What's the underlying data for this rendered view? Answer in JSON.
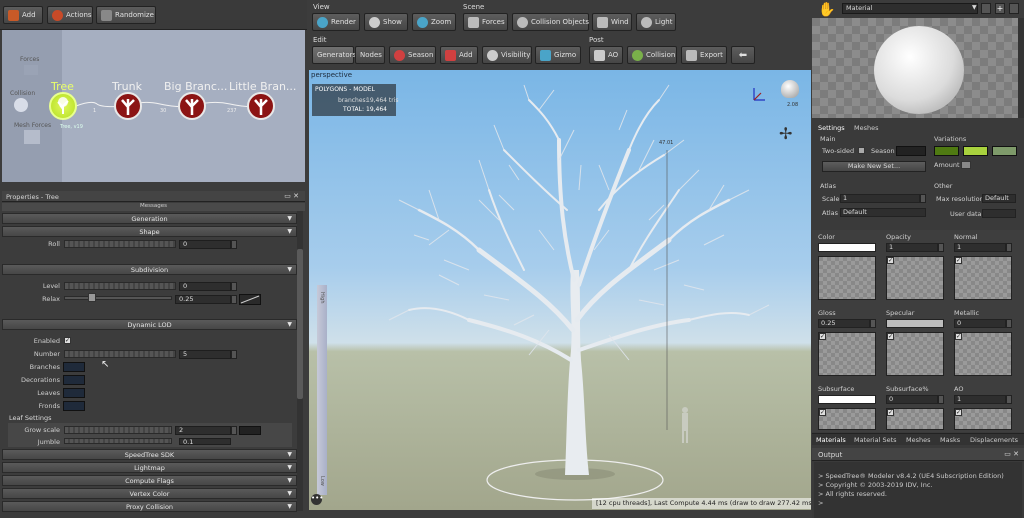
{
  "toolbar_left": {
    "add": "Add",
    "actions": "Actions",
    "randomize": "Randomize"
  },
  "generators": {
    "forces_label": "Forces",
    "collision_label": "Collision",
    "mesh_forces_label": "Mesh Forces",
    "nodes": [
      {
        "label": "Tree",
        "sub": "Tree, v19"
      },
      {
        "label": "Trunk",
        "count": "1"
      },
      {
        "label": "Big Branc...",
        "count": "30"
      },
      {
        "label": "Little Bran...",
        "count": "237"
      }
    ]
  },
  "properties": {
    "title": "Properties - Tree",
    "messages": "Messages",
    "sections": {
      "generation": "Generation",
      "shape": "Shape",
      "subdivision": "Subdivision",
      "dynamic_lod": "Dynamic LOD",
      "speedtree_sdk": "SpeedTree SDK",
      "lightmap": "Lightmap",
      "compute_flags": "Compute Flags",
      "vertex_color": "Vertex Color",
      "proxy_collision": "Proxy Collision"
    },
    "roll": {
      "label": "Roll",
      "value": "0"
    },
    "level": {
      "label": "Level",
      "value": "0"
    },
    "relax": {
      "label": "Relax",
      "value": "0.25"
    },
    "enabled": {
      "label": "Enabled",
      "checked": true
    },
    "number": {
      "label": "Number",
      "value": "5"
    },
    "branches": "Branches",
    "decorations": "Decorations",
    "leaves": "Leaves",
    "fronds": "Fronds",
    "leaf_settings": "Leaf Settings",
    "grow_scale": {
      "label": "Grow scale",
      "value": "2"
    },
    "jumble": {
      "label": "Jumble",
      "value": "0.1"
    }
  },
  "view_toolbar": {
    "group_view": "View",
    "group_scene": "Scene",
    "group_edit": "Edit",
    "group_post": "Post",
    "render": "Render",
    "show": "Show",
    "zoom": "Zoom",
    "forces": "Forces",
    "collision_objects": "Collision Objects",
    "wind": "Wind",
    "light": "Light",
    "generators": "Generators",
    "nodes": "Nodes",
    "season": "Season",
    "add": "Add",
    "visibility": "Visibility",
    "gizmo": "Gizmo",
    "ao": "AO",
    "collision": "Collision",
    "export": "Export"
  },
  "viewport": {
    "label": "perspective",
    "stats_title": "POLYGONS - MODEL",
    "branches_label": "branches:",
    "branches_value": "19,464 tris",
    "total_label": "TOTAL:",
    "total_value": "19,464",
    "height_value": "47.01",
    "light_value": "2.08",
    "status": "[12 cpu threads], Last Compute 4.44 ms (draw to draw 277.42 ms)",
    "ruler_high": "High",
    "ruler_low": "Low"
  },
  "material_panel": {
    "type": "Material",
    "tabs": [
      "Settings",
      "Meshes"
    ],
    "main": "Main",
    "two_sided": "Two-sided",
    "season": "Season",
    "make_new_set": "Make New Set...",
    "variations": "Variations",
    "amount": "Amount",
    "atlas_group": "Atlas",
    "scale_label": "Scale",
    "scale_value": "1",
    "atlas_label": "Atlas",
    "atlas_value": "Default",
    "other": "Other",
    "max_resolution": "Max resolution",
    "max_resolution_value": "Default",
    "user_data": "User data",
    "channels": [
      {
        "name": "Color",
        "value": ""
      },
      {
        "name": "Opacity",
        "value": "1"
      },
      {
        "name": "Normal",
        "value": "1"
      },
      {
        "name": "Gloss",
        "value": "0.25"
      },
      {
        "name": "Specular",
        "value": ""
      },
      {
        "name": "Metallic",
        "value": "0"
      },
      {
        "name": "Subsurface",
        "value": ""
      },
      {
        "name": "Subsurface%",
        "value": "0"
      },
      {
        "name": "AO",
        "value": "1"
      }
    ],
    "variation_colors": [
      "#4f7a12",
      "#a9d23e",
      "#7e9a6a"
    ],
    "bottom_tabs": [
      "Materials",
      "Material Sets",
      "Meshes",
      "Masks",
      "Displacements"
    ]
  },
  "output": {
    "title": "Output",
    "lines": [
      "> SpeedTree® Modeler v8.4.2 (UE4 Subscription Edition)",
      "> Copyright © 2003-2019 IDV, Inc.",
      "> All rights reserved.",
      ">"
    ]
  },
  "colors": {
    "accent_tree": "#b5e021",
    "node_red": "#8c1414"
  }
}
